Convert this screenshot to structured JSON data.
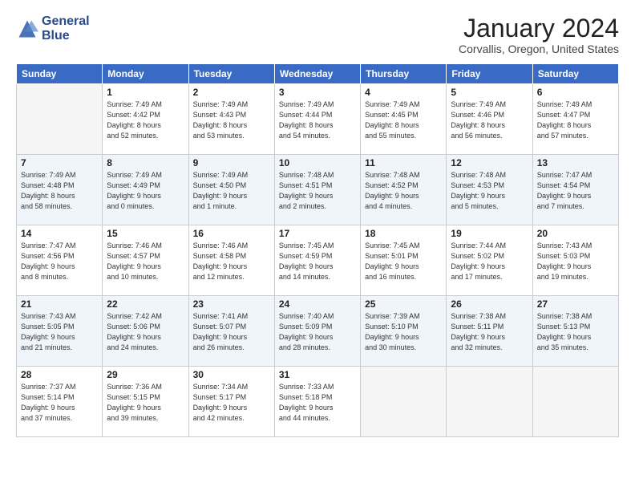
{
  "header": {
    "logo_line1": "General",
    "logo_line2": "Blue",
    "month_title": "January 2024",
    "location": "Corvallis, Oregon, United States"
  },
  "days_of_week": [
    "Sunday",
    "Monday",
    "Tuesday",
    "Wednesday",
    "Thursday",
    "Friday",
    "Saturday"
  ],
  "weeks": [
    [
      {
        "day": "",
        "info": ""
      },
      {
        "day": "1",
        "info": "Sunrise: 7:49 AM\nSunset: 4:42 PM\nDaylight: 8 hours\nand 52 minutes."
      },
      {
        "day": "2",
        "info": "Sunrise: 7:49 AM\nSunset: 4:43 PM\nDaylight: 8 hours\nand 53 minutes."
      },
      {
        "day": "3",
        "info": "Sunrise: 7:49 AM\nSunset: 4:44 PM\nDaylight: 8 hours\nand 54 minutes."
      },
      {
        "day": "4",
        "info": "Sunrise: 7:49 AM\nSunset: 4:45 PM\nDaylight: 8 hours\nand 55 minutes."
      },
      {
        "day": "5",
        "info": "Sunrise: 7:49 AM\nSunset: 4:46 PM\nDaylight: 8 hours\nand 56 minutes."
      },
      {
        "day": "6",
        "info": "Sunrise: 7:49 AM\nSunset: 4:47 PM\nDaylight: 8 hours\nand 57 minutes."
      }
    ],
    [
      {
        "day": "7",
        "info": "Sunrise: 7:49 AM\nSunset: 4:48 PM\nDaylight: 8 hours\nand 58 minutes."
      },
      {
        "day": "8",
        "info": "Sunrise: 7:49 AM\nSunset: 4:49 PM\nDaylight: 9 hours\nand 0 minutes."
      },
      {
        "day": "9",
        "info": "Sunrise: 7:49 AM\nSunset: 4:50 PM\nDaylight: 9 hours\nand 1 minute."
      },
      {
        "day": "10",
        "info": "Sunrise: 7:48 AM\nSunset: 4:51 PM\nDaylight: 9 hours\nand 2 minutes."
      },
      {
        "day": "11",
        "info": "Sunrise: 7:48 AM\nSunset: 4:52 PM\nDaylight: 9 hours\nand 4 minutes."
      },
      {
        "day": "12",
        "info": "Sunrise: 7:48 AM\nSunset: 4:53 PM\nDaylight: 9 hours\nand 5 minutes."
      },
      {
        "day": "13",
        "info": "Sunrise: 7:47 AM\nSunset: 4:54 PM\nDaylight: 9 hours\nand 7 minutes."
      }
    ],
    [
      {
        "day": "14",
        "info": "Sunrise: 7:47 AM\nSunset: 4:56 PM\nDaylight: 9 hours\nand 8 minutes."
      },
      {
        "day": "15",
        "info": "Sunrise: 7:46 AM\nSunset: 4:57 PM\nDaylight: 9 hours\nand 10 minutes."
      },
      {
        "day": "16",
        "info": "Sunrise: 7:46 AM\nSunset: 4:58 PM\nDaylight: 9 hours\nand 12 minutes."
      },
      {
        "day": "17",
        "info": "Sunrise: 7:45 AM\nSunset: 4:59 PM\nDaylight: 9 hours\nand 14 minutes."
      },
      {
        "day": "18",
        "info": "Sunrise: 7:45 AM\nSunset: 5:01 PM\nDaylight: 9 hours\nand 16 minutes."
      },
      {
        "day": "19",
        "info": "Sunrise: 7:44 AM\nSunset: 5:02 PM\nDaylight: 9 hours\nand 17 minutes."
      },
      {
        "day": "20",
        "info": "Sunrise: 7:43 AM\nSunset: 5:03 PM\nDaylight: 9 hours\nand 19 minutes."
      }
    ],
    [
      {
        "day": "21",
        "info": "Sunrise: 7:43 AM\nSunset: 5:05 PM\nDaylight: 9 hours\nand 21 minutes."
      },
      {
        "day": "22",
        "info": "Sunrise: 7:42 AM\nSunset: 5:06 PM\nDaylight: 9 hours\nand 24 minutes."
      },
      {
        "day": "23",
        "info": "Sunrise: 7:41 AM\nSunset: 5:07 PM\nDaylight: 9 hours\nand 26 minutes."
      },
      {
        "day": "24",
        "info": "Sunrise: 7:40 AM\nSunset: 5:09 PM\nDaylight: 9 hours\nand 28 minutes."
      },
      {
        "day": "25",
        "info": "Sunrise: 7:39 AM\nSunset: 5:10 PM\nDaylight: 9 hours\nand 30 minutes."
      },
      {
        "day": "26",
        "info": "Sunrise: 7:38 AM\nSunset: 5:11 PM\nDaylight: 9 hours\nand 32 minutes."
      },
      {
        "day": "27",
        "info": "Sunrise: 7:38 AM\nSunset: 5:13 PM\nDaylight: 9 hours\nand 35 minutes."
      }
    ],
    [
      {
        "day": "28",
        "info": "Sunrise: 7:37 AM\nSunset: 5:14 PM\nDaylight: 9 hours\nand 37 minutes."
      },
      {
        "day": "29",
        "info": "Sunrise: 7:36 AM\nSunset: 5:15 PM\nDaylight: 9 hours\nand 39 minutes."
      },
      {
        "day": "30",
        "info": "Sunrise: 7:34 AM\nSunset: 5:17 PM\nDaylight: 9 hours\nand 42 minutes."
      },
      {
        "day": "31",
        "info": "Sunrise: 7:33 AM\nSunset: 5:18 PM\nDaylight: 9 hours\nand 44 minutes."
      },
      {
        "day": "",
        "info": ""
      },
      {
        "day": "",
        "info": ""
      },
      {
        "day": "",
        "info": ""
      }
    ]
  ]
}
